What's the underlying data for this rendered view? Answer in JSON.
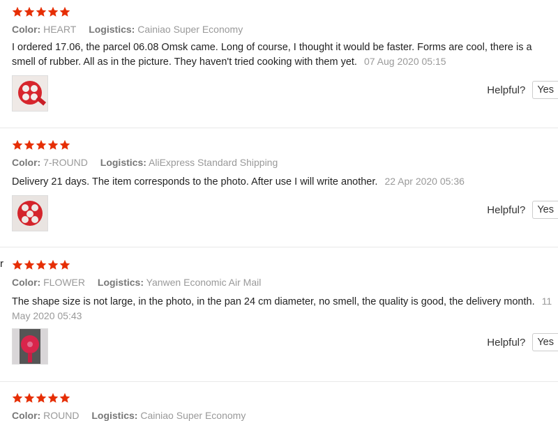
{
  "theme": {
    "star_color": "#e62e04",
    "text_color": "#222222",
    "muted_color": "#999999"
  },
  "labels": {
    "color": "Color:",
    "logistics": "Logistics:",
    "helpful": "Helpful?",
    "yes": "Yes"
  },
  "edge_text": "r",
  "reviews": [
    {
      "rating": 5,
      "color": "HEART",
      "logistics": "Cainiao Super Economy",
      "text": "I ordered 17.06, the parcel 06.08 Omsk came. Long of course, I thought it would be faster. Forms are cool, there is a smell of rubber. All as in the picture. They haven't tried cooking with them yet.",
      "date": "07 Aug 2020 05:15",
      "photo_icon": "heart-mold-photo"
    },
    {
      "rating": 5,
      "color": "7-ROUND",
      "logistics": "AliExpress Standard Shipping",
      "text": "Delivery 21 days. The item corresponds to the photo. After use I will write another.",
      "date": "22 Apr 2020 05:36",
      "photo_icon": "round-mold-photo"
    },
    {
      "rating": 5,
      "color": "FLOWER",
      "logistics": "Yanwen Economic Air Mail",
      "text": "The shape size is not large, in the photo, in the pan 24 cm diameter, no smell, the quality is good, the delivery month.",
      "date": "11 May 2020 05:43",
      "photo_icon": "flower-mold-photo"
    },
    {
      "rating": 5,
      "color": "ROUND",
      "logistics": "Cainiao Super Economy"
    }
  ]
}
